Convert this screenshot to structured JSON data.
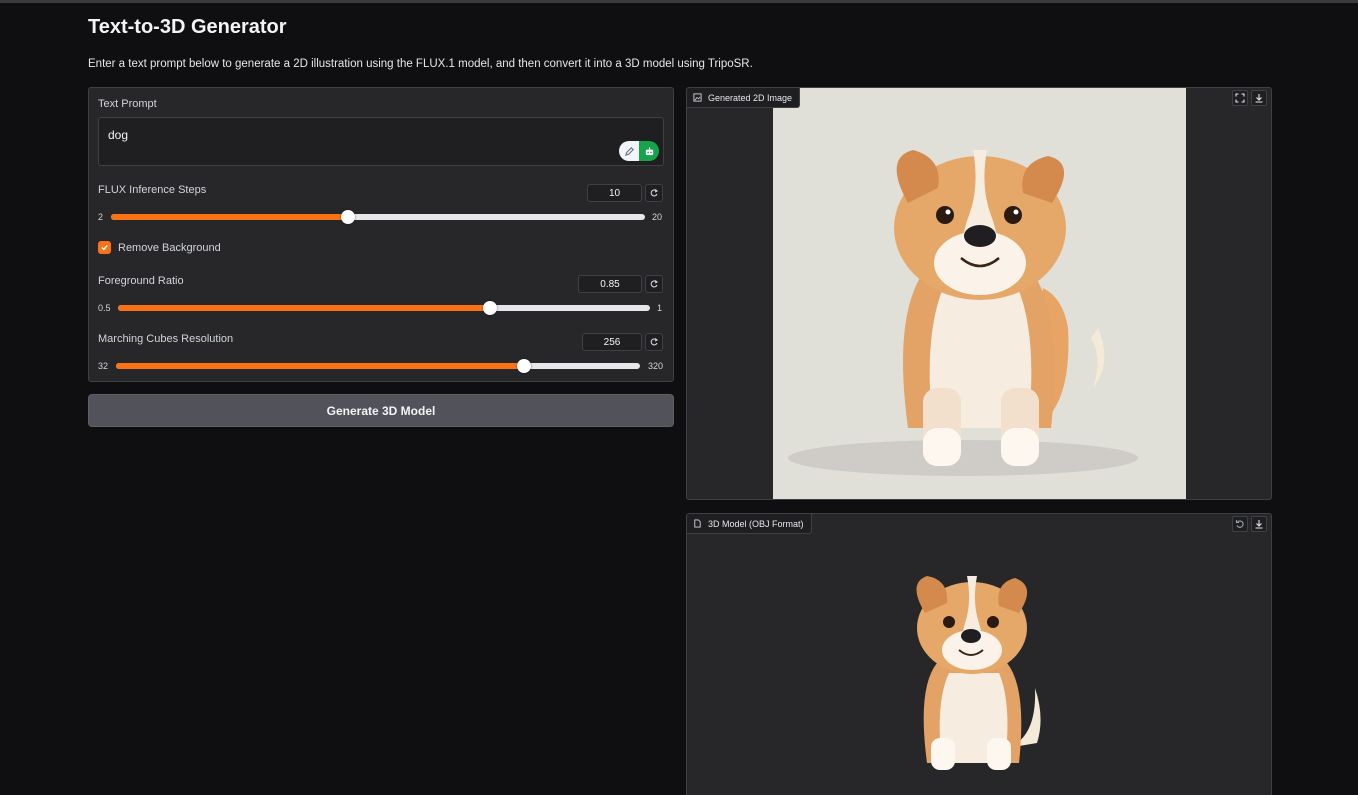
{
  "app": {
    "title": "Text-to-3D Generator",
    "description": "Enter a text prompt below to generate a 2D illustration using the FLUX.1 model, and then convert it into a 3D model using TripoSR."
  },
  "prompt": {
    "label": "Text Prompt",
    "value": "dog"
  },
  "flux_steps": {
    "label": "FLUX Inference Steps",
    "value": "10",
    "min": "2",
    "max": "20",
    "fraction": 0.444
  },
  "remove_bg": {
    "label": "Remove Background",
    "checked": true
  },
  "foreground_ratio": {
    "label": "Foreground Ratio",
    "value": "0.85",
    "min": "0.5",
    "max": "1",
    "fraction": 0.7
  },
  "marching_cubes": {
    "label": "Marching Cubes Resolution",
    "value": "256",
    "min": "32",
    "max": "320",
    "fraction": 0.778
  },
  "generate_button": {
    "label": "Generate 3D Model"
  },
  "image_output": {
    "label": "Generated 2D Image"
  },
  "model_output": {
    "label": "3D Model (OBJ Format)"
  },
  "colors": {
    "accent": "#f97316",
    "background": "#0f0f11",
    "panel": "#27272a",
    "button": "#52525b"
  },
  "icons": [
    "image-icon",
    "fullscreen-icon",
    "download-icon",
    "file-icon",
    "undo-icon",
    "reset-icon",
    "check-icon",
    "pen-icon",
    "robot-icon"
  ]
}
